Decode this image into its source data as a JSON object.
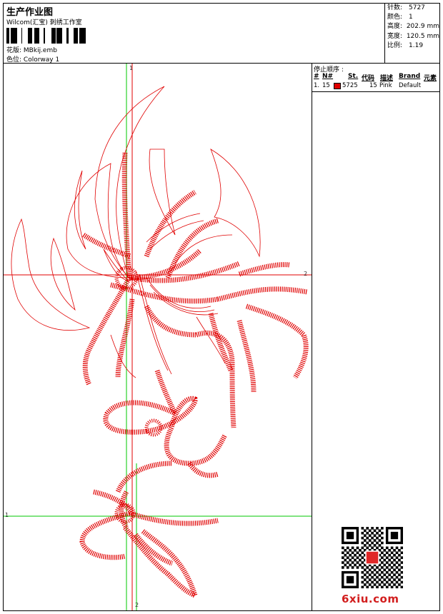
{
  "header": {
    "title": "生产作业图",
    "subtitle": "Wilcom(汇宝) 刺绣工作室",
    "design_label": "花版:",
    "design_value": "MBkij.emb",
    "colorway_label": "色位:",
    "colorway_value": "Colorway 1"
  },
  "stats": [
    {
      "label": "针数:",
      "value": "5727"
    },
    {
      "label": "颜色:",
      "value": "1"
    },
    {
      "label": "高度:",
      "value": "202.9 mm"
    },
    {
      "label": "宽度:",
      "value": "120.5 mm"
    },
    {
      "label": "比例:",
      "value": "1.19"
    }
  ],
  "stop_sequence": {
    "title": "停止顺序 :",
    "headers": [
      "#",
      "N#",
      "St.",
      "代码",
      "描述",
      "Brand",
      "元素"
    ],
    "rows": [
      {
        "index": "1.",
        "needle": "15",
        "code": "5725",
        "st": "15",
        "desc": "Pink",
        "brand": "Default",
        "color": "#e00000"
      }
    ]
  },
  "axis_labels": {
    "v_top": "1",
    "h_right": "2",
    "h_left": "1",
    "v_bottom": "2"
  },
  "watermark": "6xiu.com",
  "colors": {
    "stitch": "#e00000",
    "guide_green": "#00c800",
    "guide_red": "#e00000"
  }
}
